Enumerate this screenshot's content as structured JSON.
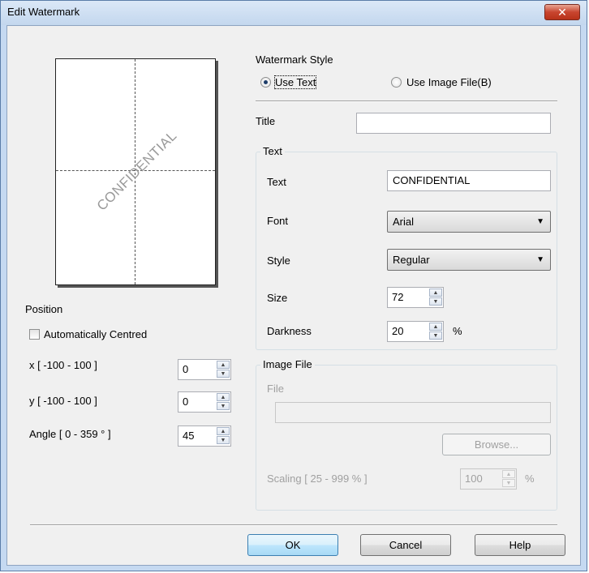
{
  "window": {
    "title": "Edit Watermark",
    "close_glyph": "✕"
  },
  "preview": {
    "watermark_text": "CONFIDENTIAL"
  },
  "position": {
    "heading": "Position",
    "auto_centred_label": "Automatically Centred",
    "auto_centred_checked": false,
    "x_label": "x [ -100  -  100 ]",
    "x_value": "0",
    "y_label": "y [ -100  -  100 ]",
    "y_value": "0",
    "angle_label": "Angle [ 0 - 359 ° ]",
    "angle_value": "45"
  },
  "style": {
    "heading": "Watermark Style",
    "use_text_label": "Use Text",
    "use_image_label": "Use Image File(B)",
    "selected": "use_text"
  },
  "title_field": {
    "label": "Title",
    "value": ""
  },
  "text_group": {
    "heading": "Text",
    "text_label": "Text",
    "text_value": "CONFIDENTIAL",
    "font_label": "Font",
    "font_value": "Arial",
    "style_label": "Style",
    "style_value": "Regular",
    "size_label": "Size",
    "size_value": "72",
    "darkness_label": "Darkness",
    "darkness_value": "20",
    "darkness_unit": "%"
  },
  "image_group": {
    "heading": "Image File",
    "file_label": "File",
    "file_value": "",
    "browse_label": "Browse...",
    "scaling_label": "Scaling [ 25 - 999 % ]",
    "scaling_value": "100",
    "scaling_unit": "%"
  },
  "buttons": {
    "ok": "OK",
    "cancel": "Cancel",
    "help": "Help"
  },
  "icons": {
    "spin_up": "▲",
    "spin_down": "▼",
    "dropdown": "▼"
  }
}
